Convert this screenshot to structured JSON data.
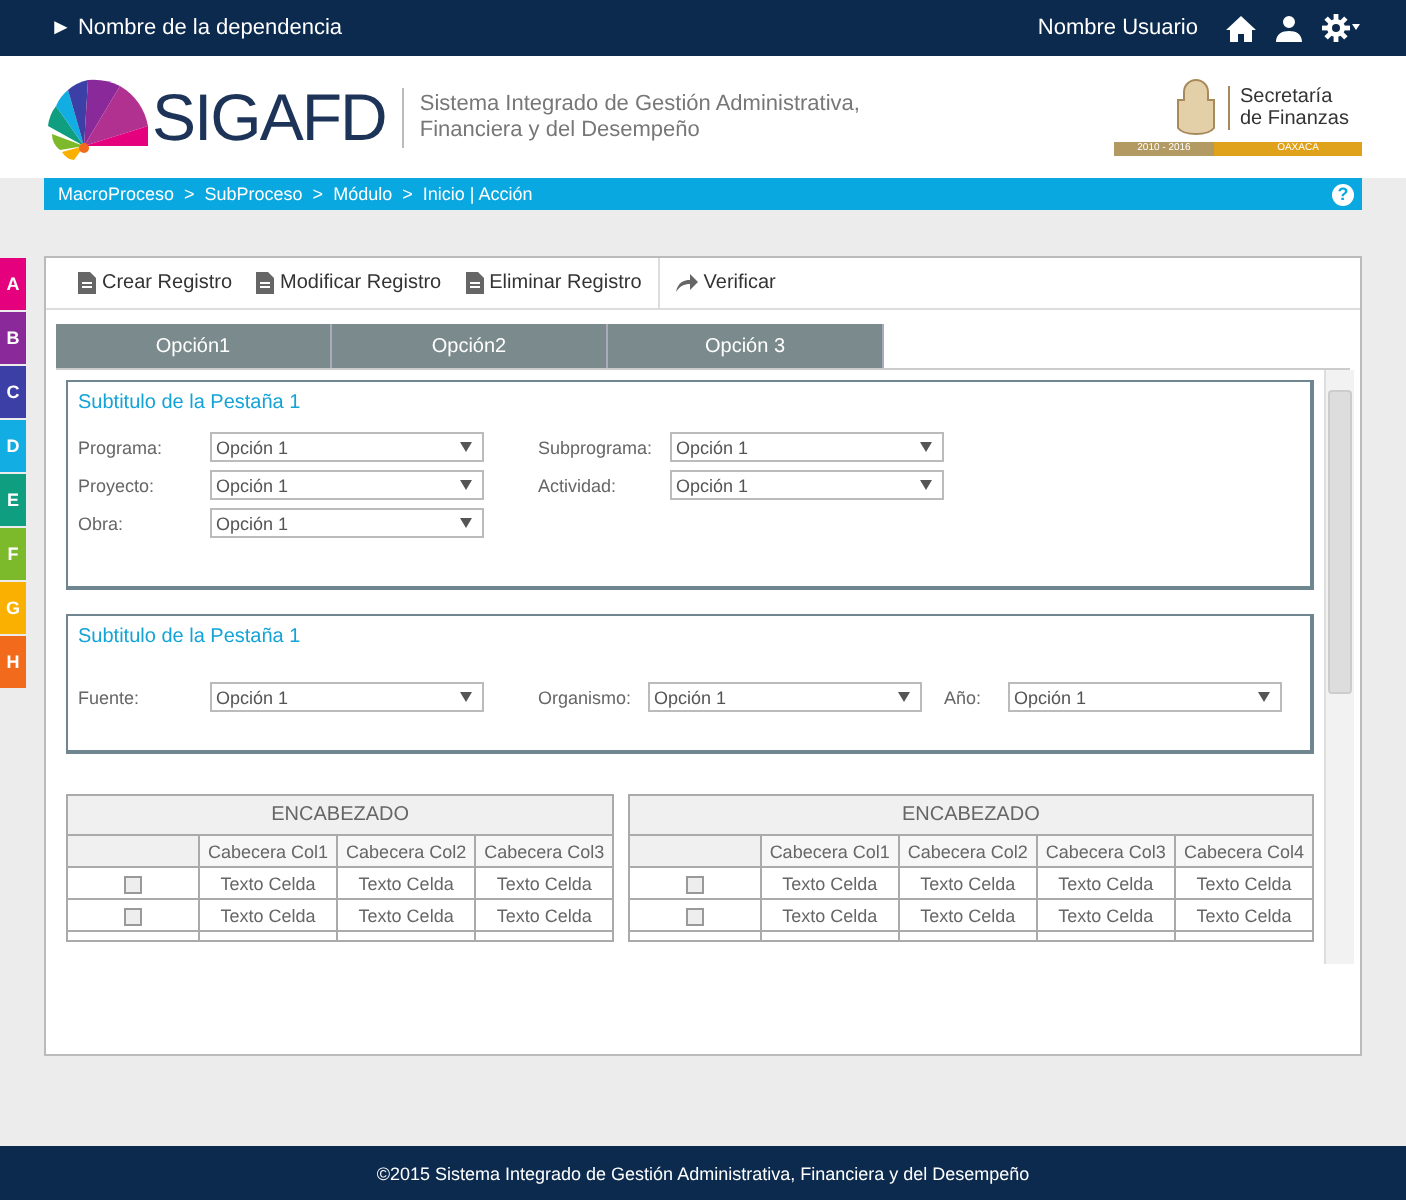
{
  "top_bar": {
    "dependency": "► Nombre de la dependencia",
    "user": "Nombre Usuario"
  },
  "header": {
    "logo_text": "SIGAFD",
    "system_name": "Sistema Integrado de Gestión Administrativa, Financiera y del Desempeño",
    "secretaria": "Secretaría de Finanzas",
    "years": "2010 - 2016",
    "state": "OAXACA"
  },
  "breadcrumb": {
    "path": "MacroProceso  >  SubProceso  >  Módulo  >  Inicio | Acción",
    "help": "?"
  },
  "side_tabs": [
    {
      "label": "A",
      "color": "#e5007e"
    },
    {
      "label": "B",
      "color": "#8a2a9a"
    },
    {
      "label": "C",
      "color": "#3c3fa6"
    },
    {
      "label": "D",
      "color": "#12aee3"
    },
    {
      "label": "E",
      "color": "#0f9e7f"
    },
    {
      "label": "F",
      "color": "#7dba2b"
    },
    {
      "label": "G",
      "color": "#f9b000"
    },
    {
      "label": "H",
      "color": "#f26a1b"
    }
  ],
  "toolbar": [
    {
      "kind": "doc",
      "label": "Crear Registro"
    },
    {
      "kind": "doc",
      "label": "Modificar Registro"
    },
    {
      "kind": "doc",
      "label": "Eliminar Registro"
    },
    {
      "kind": "arrow",
      "label": "Verificar"
    }
  ],
  "tabs": [
    {
      "label": "Opción1",
      "selected": false
    },
    {
      "label": "Opción2",
      "selected": false
    },
    {
      "label": "Opción 3",
      "selected": false
    }
  ],
  "sections": [
    {
      "title": "Subtitulo de la Pestaña 1",
      "rows": [
        [
          {
            "label": "Programa:",
            "value": "Opción 1"
          },
          {
            "label": "Subprograma:",
            "value": "Opción 1"
          }
        ],
        [
          {
            "label": "Proyecto:",
            "value": "Opción 1"
          },
          {
            "label": "Actividad:",
            "value": "Opción 1"
          }
        ],
        [
          {
            "label": "Obra:",
            "value": "Opción 1"
          }
        ]
      ]
    },
    {
      "title": "Subtitulo de la Pestaña 1",
      "rows": [
        [
          {
            "label": "Fuente:",
            "value": "Opción 1"
          },
          {
            "label": "Organismo:",
            "value": "Opción 1"
          },
          {
            "label": "Año:",
            "value": "Opción 1"
          }
        ]
      ]
    }
  ],
  "tables": [
    {
      "title": "ENCABEZADO",
      "columns": [
        "Cabecera Col1",
        "Cabecera Col2",
        "Cabecera Col3"
      ],
      "rows": [
        {
          "checked": false,
          "cells": [
            "Texto Celda",
            "Texto Celda",
            "Texto Celda"
          ]
        },
        {
          "checked": false,
          "cells": [
            "Texto Celda",
            "Texto Celda",
            "Texto Celda"
          ]
        }
      ]
    },
    {
      "title": "ENCABEZADO",
      "columns": [
        "Cabecera Col1",
        "Cabecera Col2",
        "Cabecera Col3",
        "Cabecera Col4"
      ],
      "rows": [
        {
          "checked": false,
          "cells": [
            "Texto Celda",
            "Texto Celda",
            "Texto Celda",
            "Texto Celda"
          ]
        },
        {
          "checked": false,
          "cells": [
            "Texto Celda",
            "Texto Celda",
            "Texto Celda",
            "Texto Celda"
          ]
        }
      ]
    }
  ],
  "footer": "©2015 Sistema Integrado de Gestión Administrativa, Financiera y del Desempeño"
}
